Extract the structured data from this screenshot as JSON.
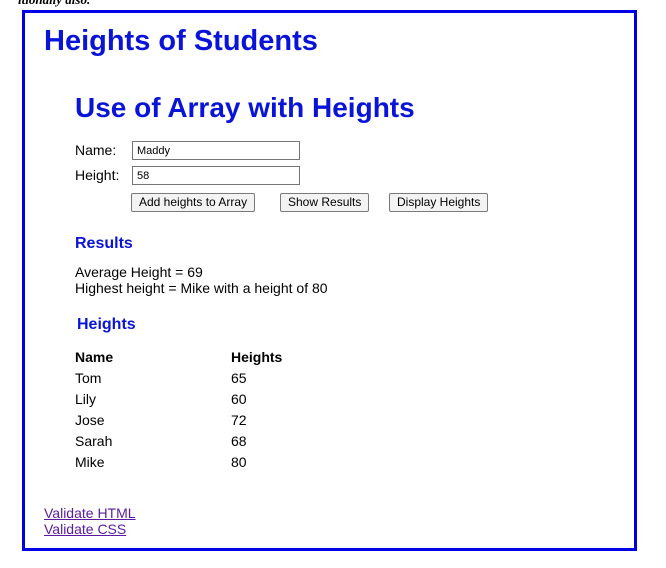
{
  "top_strip_text": "itionally also.",
  "page": {
    "main_title": "Heights of Students",
    "section_title": "Use of Array with Heights"
  },
  "form": {
    "name_label": "Name:",
    "name_value": "Maddy",
    "height_label": "Height:",
    "height_value": "58",
    "buttons": {
      "add": "Add heights to Array",
      "show": "Show Results",
      "display": "Display Heights"
    }
  },
  "results": {
    "heading": "Results",
    "average": "Average Height = 69",
    "highest": "Highest height = Mike with a height of 80"
  },
  "heights": {
    "heading": "Heights",
    "columns": [
      "Name",
      "Heights"
    ],
    "rows": [
      {
        "name": "Tom",
        "height": "65"
      },
      {
        "name": "Lily",
        "height": "60"
      },
      {
        "name": "Jose",
        "height": "72"
      },
      {
        "name": "Sarah",
        "height": "68"
      },
      {
        "name": "Mike",
        "height": "80"
      }
    ]
  },
  "links": {
    "validate_html": "Validate HTML",
    "validate_css": "Validate CSS"
  },
  "colors": {
    "heading_blue": "#0a14d9",
    "frame_blue": "#0000e6",
    "visited_link": "#5a1aa1"
  }
}
